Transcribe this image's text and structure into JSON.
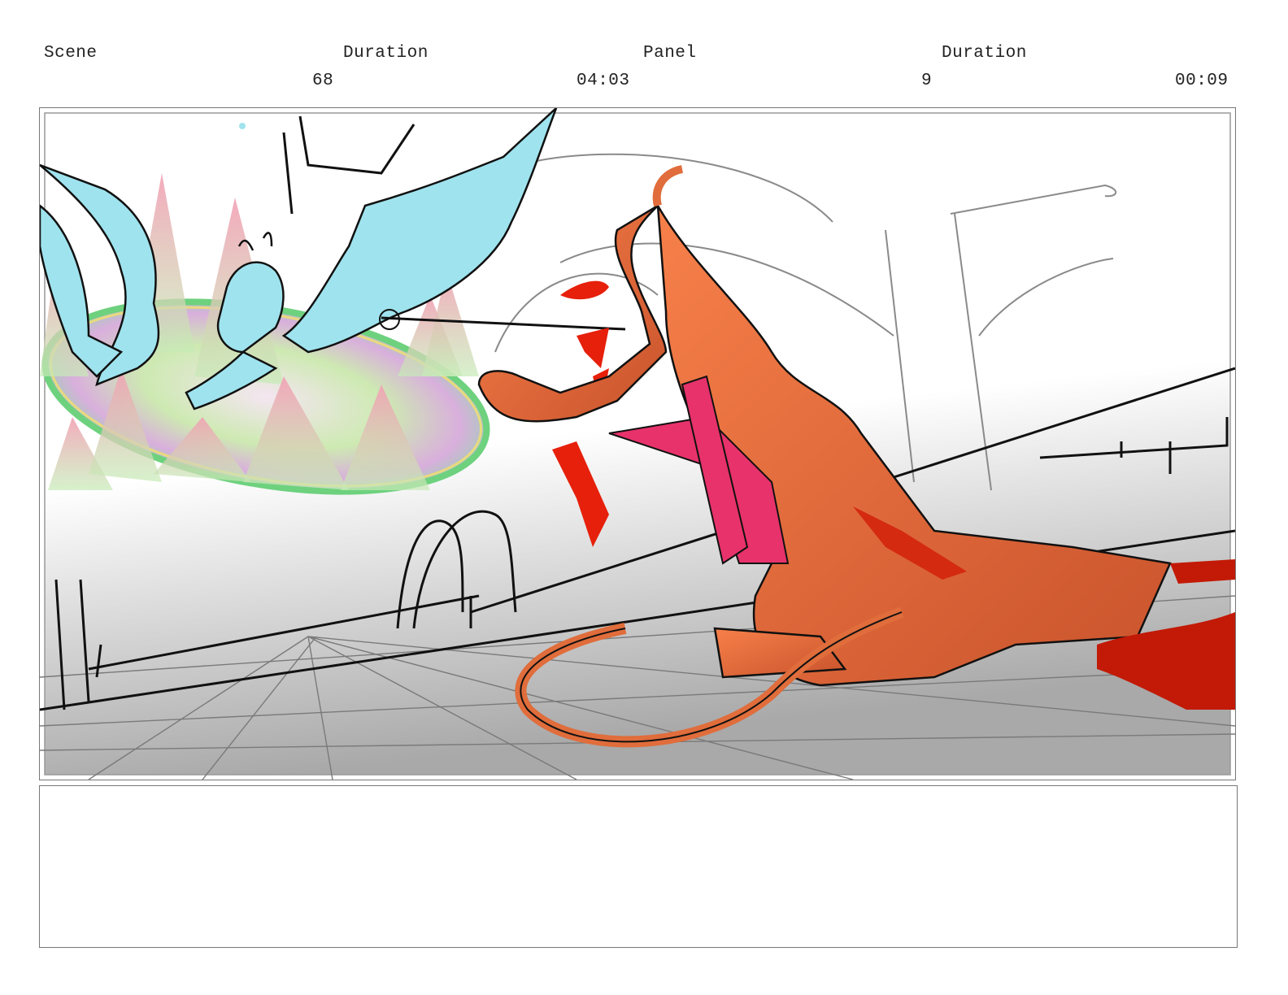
{
  "header": {
    "scene_label": "Scene",
    "scene_duration_label": "Duration",
    "panel_label": "Panel",
    "panel_duration_label": "Duration",
    "scene_value": "68",
    "scene_duration_value": "04:03",
    "panel_value": "9",
    "panel_duration_value": "00:09"
  },
  "panel_image": {
    "description_colors": {
      "fairy": "#9fe3ee",
      "devil": "#ef7a45",
      "blood": "#d42a10",
      "sash": "#e8326b",
      "line": "#111111",
      "sketch": "#888888"
    }
  },
  "notes": {
    "text": ""
  }
}
